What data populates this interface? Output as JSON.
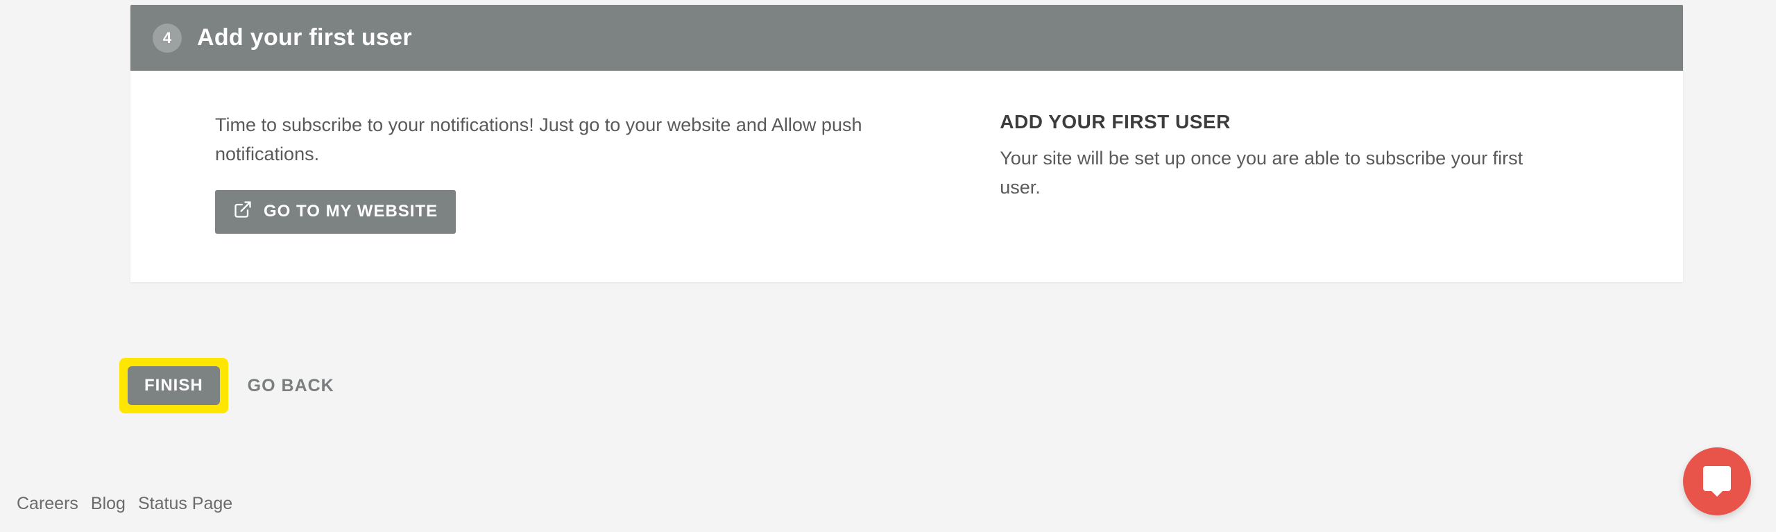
{
  "step": {
    "number": "4",
    "title": "Add your first user"
  },
  "left": {
    "instruction": "Time to subscribe to your notifications! Just go to your website and Allow push notifications.",
    "goto_label": "GO TO MY WEBSITE"
  },
  "right": {
    "heading": "ADD YOUR FIRST USER",
    "description": "Your site will be set up once you are able to subscribe your first user."
  },
  "actions": {
    "finish": "FINISH",
    "go_back": "GO BACK"
  },
  "footer": {
    "careers": "Careers",
    "blog": "Blog",
    "status": "Status Page"
  }
}
